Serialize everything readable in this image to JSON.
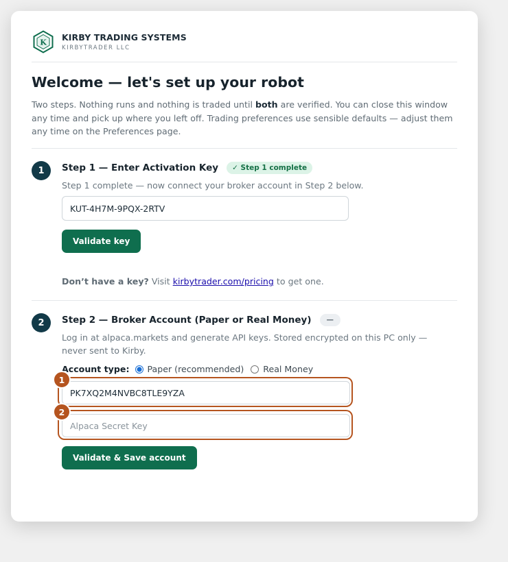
{
  "brand": {
    "name": "KIRBY TRADING SYSTEMS",
    "subtitle": "KIRBYTRADER LLC",
    "logo_letter": "K"
  },
  "page": {
    "title": "Welcome — let's set up your robot",
    "intro_before": "Two steps. Nothing runs and nothing is traded until ",
    "intro_bold": "both",
    "intro_after": " are verified. You can close this window any time and pick up where you left off. Trading preferences use sensible defaults — adjust them any time on the Preferences page."
  },
  "step1": {
    "number": "1",
    "title": "Step 1 — Enter Activation Key",
    "badge": "✓ Step 1 complete",
    "description": "Step 1 complete — now connect your broker account in Step 2 below.",
    "key_value": "KUT-4H7M-9PQX-2RTV",
    "validate_label": "Validate key",
    "nokey_bold": "Don’t have a key?",
    "nokey_prefix": " Visit ",
    "nokey_link": "kirbytrader.com/pricing",
    "nokey_suffix": " to get one."
  },
  "step2": {
    "number": "2",
    "title": "Step 2 — Broker Account (Paper or Real Money)",
    "badge": "—",
    "description": "Log in at alpaca.markets and generate API keys. Stored encrypted on this PC only — never sent to Kirby.",
    "account_type_label": "Account type:",
    "option_paper": "Paper (recommended)",
    "option_real": "Real Money",
    "selected_option": "paper",
    "api_key_value": "PK7XQ2M4NVBC8TLE9YZA",
    "secret_placeholder": "Alpaca Secret Key",
    "save_label": "Validate & Save account"
  },
  "annotations": {
    "marker_1": "1",
    "marker_2": "2",
    "color": "#b5541f"
  },
  "colors": {
    "primary_button": "#0f6e4e",
    "step_circle": "#123a48",
    "success_badge_bg": "#dcf3e7",
    "success_badge_text": "#157046"
  }
}
